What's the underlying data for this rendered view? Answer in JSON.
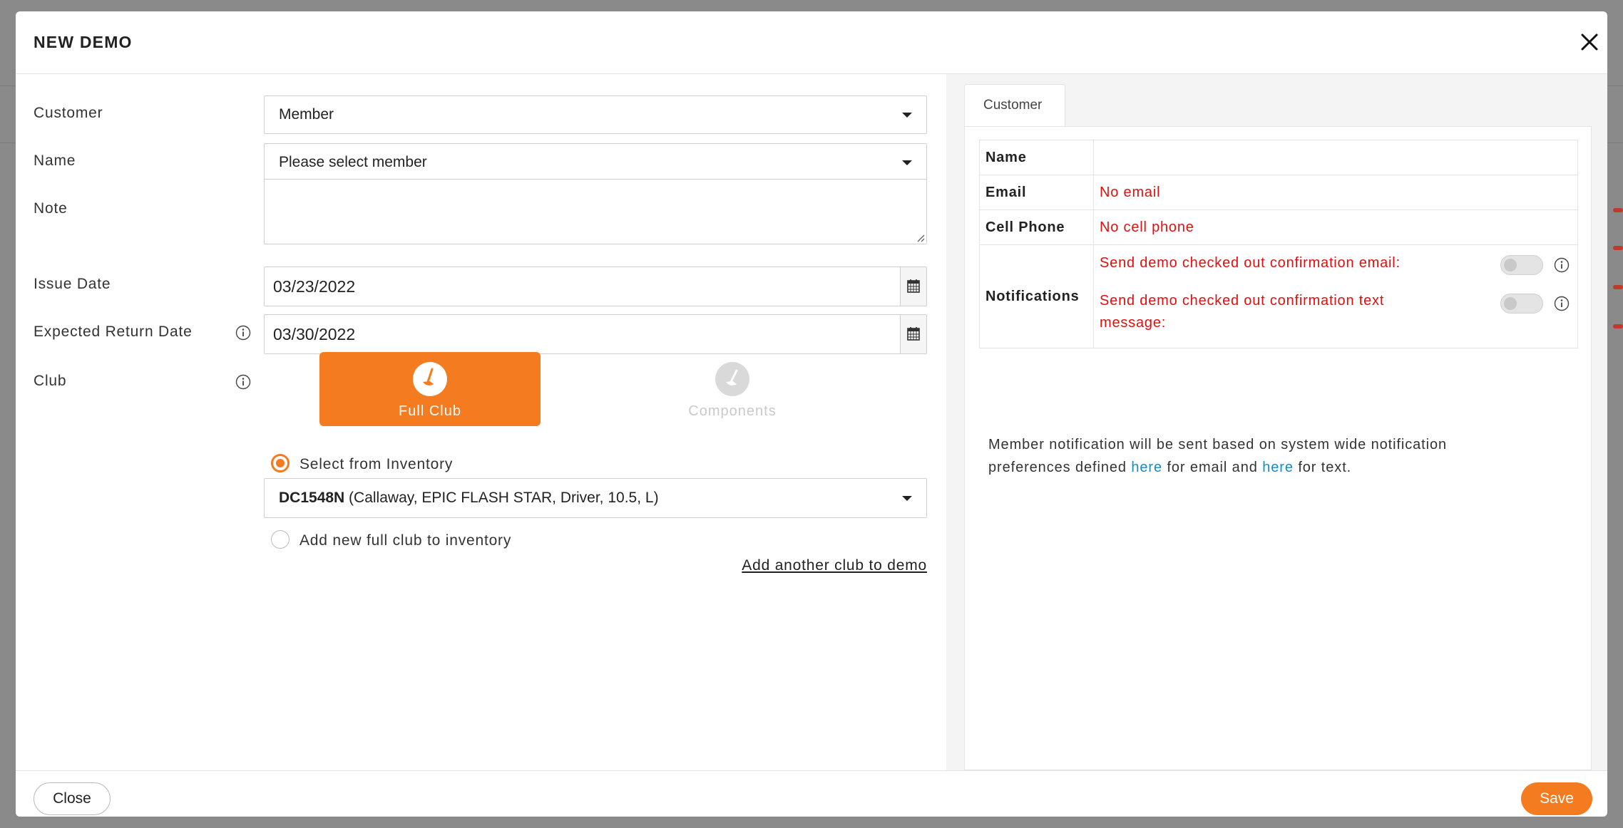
{
  "dialog": {
    "title": "NEW DEMO"
  },
  "form": {
    "customer": {
      "label": "Customer",
      "value": "Member"
    },
    "name": {
      "label": "Name",
      "value": "Please select member"
    },
    "note": {
      "label": "Note",
      "value": ""
    },
    "issue_date": {
      "label": "Issue Date",
      "value": "03/23/2022"
    },
    "expected_return_date": {
      "label": "Expected Return Date",
      "value": "03/30/2022"
    },
    "club": {
      "label": "Club",
      "options": [
        {
          "label": "Full Club",
          "selected": true,
          "icon": "golf-club-icon"
        },
        {
          "label": "Components",
          "selected": false,
          "icon": "golf-club-icon"
        }
      ],
      "select_from_inventory": {
        "label": "Select from Inventory",
        "checked": true
      },
      "inventory_item": {
        "code": "DC1548N",
        "details": " (Callaway, EPIC FLASH STAR, Driver, 10.5, L)"
      },
      "add_new": {
        "label": "Add new full club to inventory",
        "checked": false
      },
      "add_another_link": "Add another club to demo"
    }
  },
  "customer_panel": {
    "tab_label": "Customer",
    "rows": {
      "name": {
        "key": "Name",
        "value": ""
      },
      "email": {
        "key": "Email",
        "value": "No email"
      },
      "cell_phone": {
        "key": "Cell Phone",
        "value": "No cell phone"
      },
      "notifications": {
        "key": "Notifications",
        "email_label": "Send demo checked out confirmation email:",
        "email_enabled": false,
        "text_label": "Send demo checked out confirmation text message:",
        "text_enabled": false
      }
    },
    "note": {
      "part1": "Member notification will be sent based on system wide notification preferences defined ",
      "link1": "here",
      "part2": " for email and ",
      "link2": "here",
      "part3": " for text."
    }
  },
  "footer": {
    "close_label": "Close",
    "save_label": "Save"
  },
  "colors": {
    "accent": "#f47b20",
    "error": "#e01010",
    "link": "#1a8bbf"
  }
}
